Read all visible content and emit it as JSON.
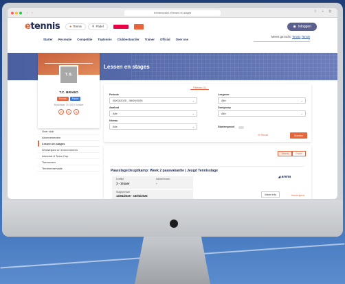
{
  "browser": {
    "url": "tennisenpadel.nl/lessen-en-stages",
    "traffic_lights": [
      "#ff5f57",
      "#febc2e",
      "#28c840"
    ]
  },
  "header": {
    "logo_main": "tennis",
    "logo_tag": "BY KNLTB",
    "sport_tennis": "Tennis",
    "sport_padel": "Padel",
    "login": "Inloggen"
  },
  "menu": {
    "items": [
      "Starter",
      "Recreatie",
      "Competitie",
      "Toptennis",
      "Clubbestuurder",
      "Trainer",
      "Official",
      "Over ons"
    ],
    "most_searched_label": "Meest gezocht:",
    "most_searched_links": [
      "Tennis",
      "Tennis"
    ]
  },
  "hero": {
    "title": "Lessen en stages"
  },
  "club": {
    "initials": "T. B.",
    "name": "T.C. BRABO",
    "tags": [
      "Tennis",
      "Padel"
    ],
    "address": "Bosselaar 74 2970 Schilde"
  },
  "side_menu": [
    "Over club",
    "Abonnementen",
    "Lessen en stages",
    "Wedstrijden en evenementen",
    "Interclub & Team Cup",
    "Toernooien",
    "Terreinreservatie"
  ],
  "filters": {
    "tab_label": "Filteren (1)",
    "periode_label": "Periode",
    "periode_value": "08/03/2025 - 08/09/2026",
    "lesgever_label": "Lesgever",
    "lesgever_value": "Alle",
    "aanbod_label": "Aanbod",
    "aanbod_value": "Alle",
    "doelgroep_label": "Doelgroep",
    "doelgroep_value": "Alle",
    "niveau_label": "Niveau",
    "niveau_value": "Alle",
    "startersproof_label": "Startersproof",
    "reset_label": "Reset",
    "zoeken_label": "Zoeken"
  },
  "results": {
    "sport_tabs": [
      "Tennis",
      "Padel"
    ],
    "card_title": "Paasstage/Jeugdkamp: Week 2 paasvakantie | Jeugd Tennisstage",
    "leeftijd_label": "Leeftijd",
    "leeftijd_value": "3 - 14 jaar",
    "lessen_label": "Aantal lessen",
    "lessen_value": "-",
    "periode_label": "Stageperiode",
    "periode_value": "14/04/2025 - 18/04/2025",
    "organizer": "arena",
    "more_label": "Meer info",
    "register_label": "Inschrijven"
  },
  "colors": {
    "accent": "#e8643a",
    "navy": "#1e2a5a",
    "hero": "#4a5fa0"
  }
}
